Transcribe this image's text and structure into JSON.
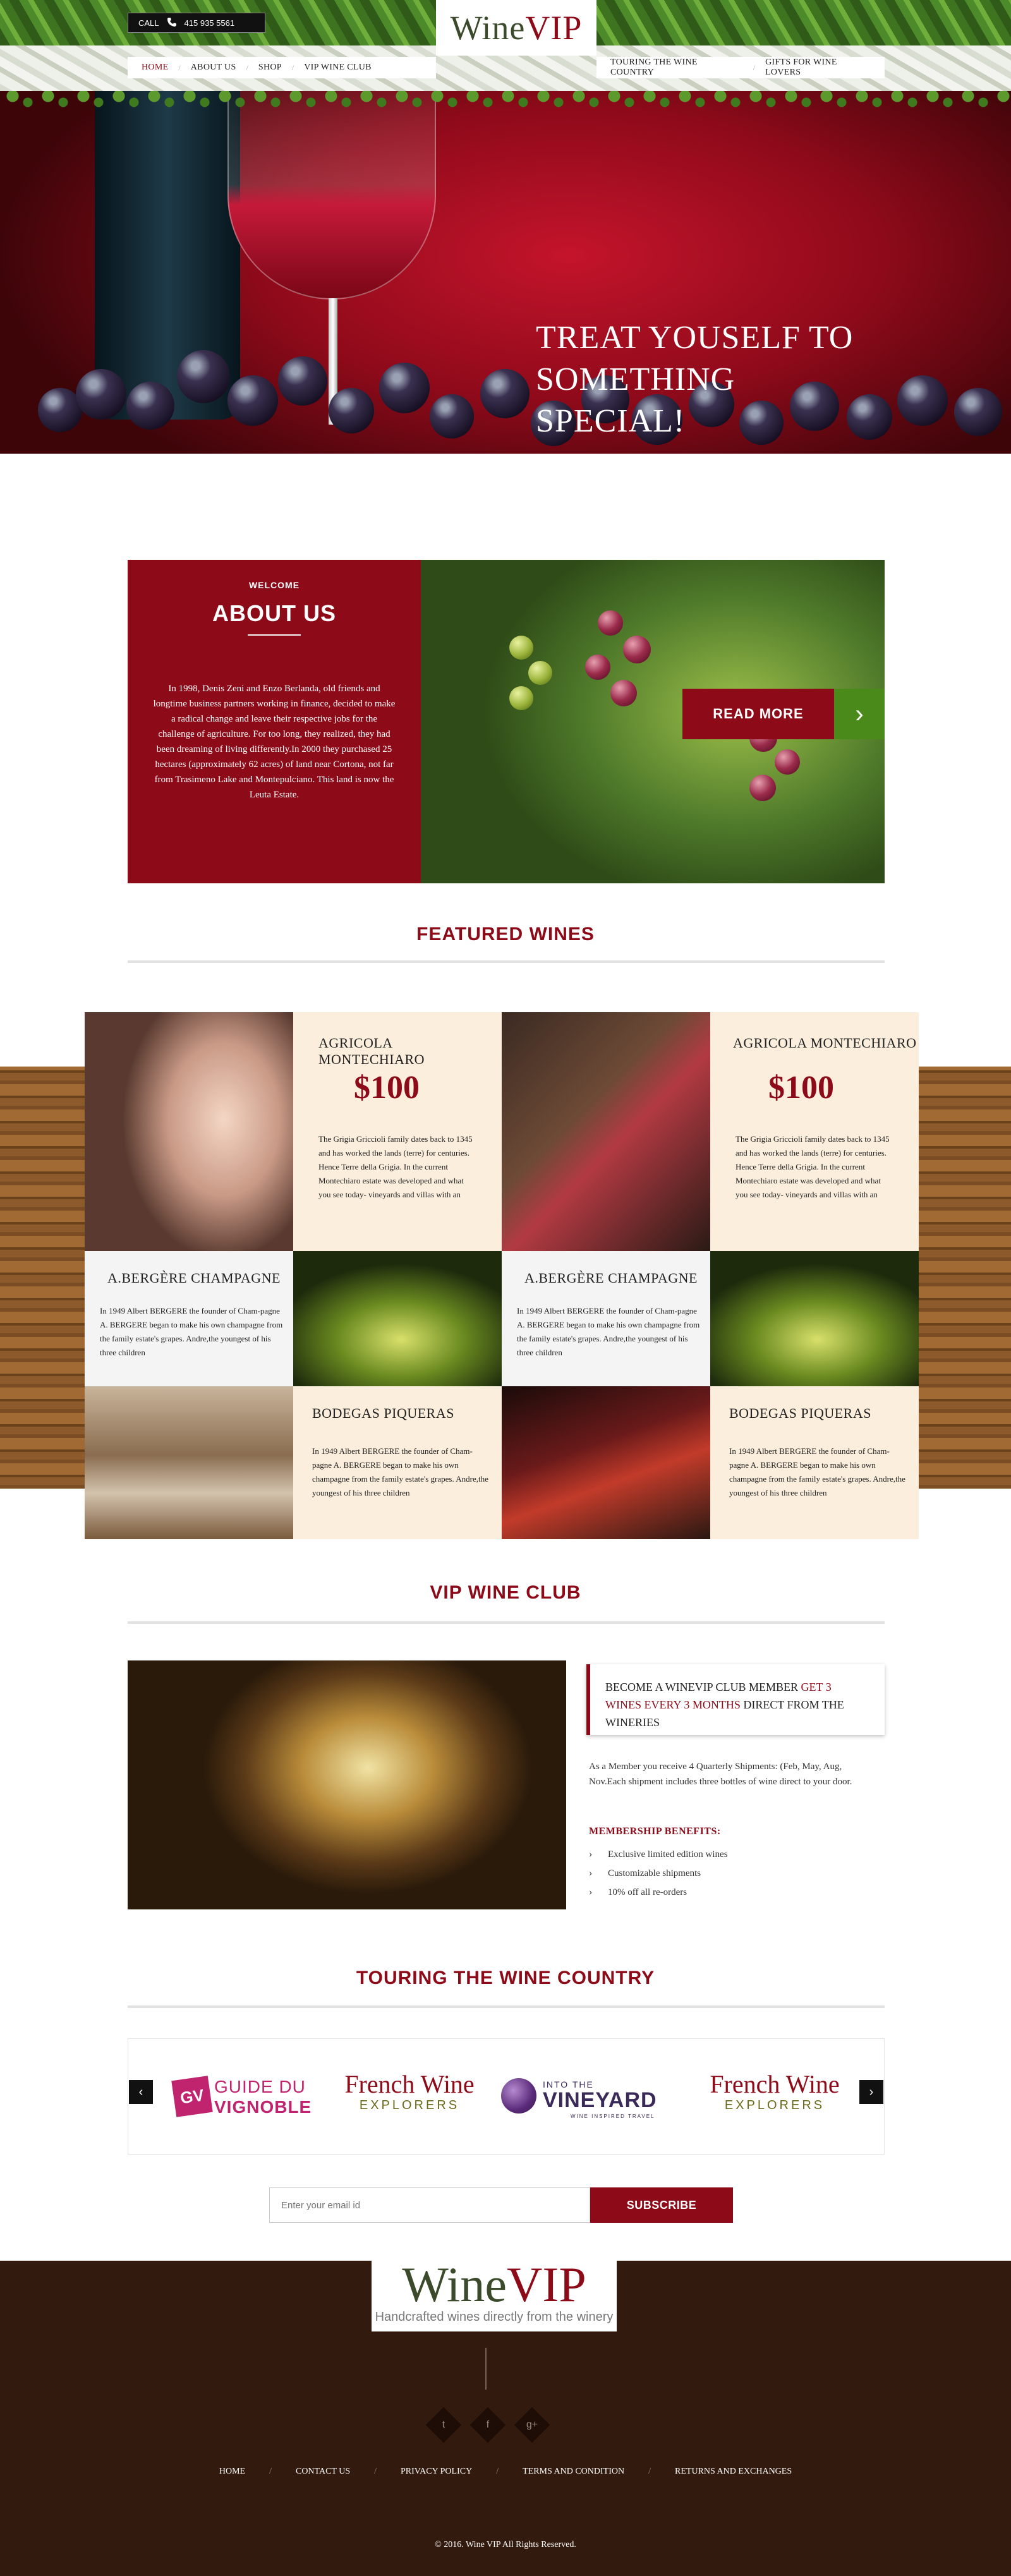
{
  "header": {
    "call_label": "CALL",
    "phone": "415 935 5561",
    "logo_text_a": "Wine",
    "logo_text_b": "VIP",
    "nav_left": [
      {
        "label": "HOME",
        "active": true
      },
      {
        "label": "ABOUT US"
      },
      {
        "label": "SHOP"
      },
      {
        "label": "VIP WINE CLUB"
      }
    ],
    "nav_right": [
      {
        "label": "TOURING THE WINE COUNTRY"
      },
      {
        "label": "GIFTS FOR WINE LOVERS"
      }
    ],
    "nav_separator": "/"
  },
  "hero": {
    "title_line1": "TREAT YOUSELF TO",
    "title_line2": "SOMETHING SPECIAL!"
  },
  "about": {
    "welcome": "WELCOME",
    "title": "ABOUT US",
    "text": "In 1998, Denis Zeni and Enzo Berlanda, old friends and longtime business partners working in finance, decided to make a radical change and leave their respective jobs for the challenge of agriculture. For too long, they realized, they had been dreaming of living differently.In 2000 they purchased 25 hectares (approximately 62 acres) of land near Cortona, not far from Trasimeno Lake and Montepulciano. This land is now the Leuta Estate.",
    "read_more": "READ MORE",
    "arrow": "›"
  },
  "featured": {
    "title": "FEATURED WINES",
    "row1": [
      {
        "name": "AGRICOLA MONTECHIARO",
        "price": "$100",
        "desc": "The Grigia Griccioli family dates back to 1345 and has worked the lands (terre) for centuries. Hence Terre della Grigia. In the current Montechiaro estate was developed and what you see today- vineyards and villas with an"
      },
      {
        "name": "AGRICOLA MONTECHIARO",
        "price": "$100",
        "desc": "The Grigia Griccioli family dates back to 1345 and has worked the lands (terre) for centuries. Hence Terre della Grigia. In the current Montechiaro estate was developed and what you see today- vineyards and villas with an"
      }
    ],
    "row2": [
      {
        "name": "A.BERGÈRE CHAMPAGNE",
        "desc": "In 1949 Albert BERGERE the founder of Cham-pagne A. BERGERE began to make his own champagne from the family estate's grapes. Andre,the youngest of his three children"
      },
      {
        "name": "A.BERGÈRE CHAMPAGNE",
        "desc": "In 1949 Albert BERGERE the founder of Cham-pagne A. BERGERE began to make his own champagne from the family estate's grapes. Andre,the youngest of his three children"
      }
    ],
    "row3": [
      {
        "name": "BODEGAS PIQUERAS",
        "desc": "In 1949 Albert BERGERE the founder of Cham-pagne A. BERGERE began to make his own champagne from the family estate's grapes. Andre,the youngest of his three children"
      },
      {
        "name": "BODEGAS PIQUERAS",
        "desc": "In 1949 Albert BERGERE the founder of Cham-pagne A. BERGERE began to make his own champagne from the family estate's grapes. Andre,the youngest of his three children"
      }
    ]
  },
  "club": {
    "title": "VIP WINE CLUB",
    "box_a": "BECOME A WINEVIP CLUB MEMBER ",
    "box_hl1": "GET 3 WINES EVERY 3 MONTHS",
    "box_b": " DIRECT FROM THE WINERIES",
    "text": "As a Member you receive 4 Quarterly Shipments: (Feb, May, Aug, Nov.Each shipment includes three bottles of wine direct to your door.",
    "benefits_title": "MEMBERSHIP BENEFITS:",
    "benefits": [
      "Exclusive limited edition wines",
      "Customizable shipments",
      "10% off all re-orders"
    ],
    "bullet": "›"
  },
  "touring": {
    "title": "TOURING THE WINE COUNTRY",
    "prev": "‹",
    "next": "›",
    "logos": [
      {
        "badge": "GV",
        "line1": "GUIDE DU",
        "line2": "VIGNOBLE"
      },
      {
        "line1": "French Wine",
        "line2": "EXPLORERS"
      },
      {
        "line1": "INTO THE",
        "line2": "VINEYARD",
        "line3": "WINE INSPIRED TRAVEL"
      },
      {
        "line1": "French Wine",
        "line2": "EXPLORERS"
      }
    ]
  },
  "newsletter": {
    "placeholder": "Enter your email id",
    "button": "SUBSCRIBE"
  },
  "footer": {
    "logo_a": "Wine",
    "logo_b": "VIP",
    "tagline": "Handcrafted wines directly from the winery",
    "social": [
      "t",
      "f",
      "g+"
    ],
    "menu": [
      "HOME",
      "CONTACT US",
      "PRIVACY POLICY",
      "TERMS AND CONDITION",
      "RETURNS AND EXCHANGES"
    ],
    "separator": "/",
    "copyright": "© 2016. Wine VIP All Rights Reserved."
  },
  "colors": {
    "brand_red": "#8d0a18",
    "leaf_green": "#4a8a1a",
    "footer_brown": "#331a0e",
    "cream": "#fbeedd"
  },
  "icons": [
    "phone-icon",
    "chevron-right-icon",
    "chevron-left-icon",
    "twitter-icon",
    "facebook-icon",
    "google-plus-icon"
  ]
}
